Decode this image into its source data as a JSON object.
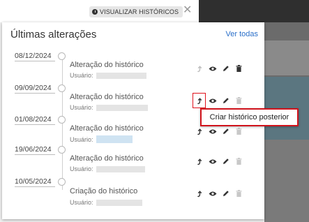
{
  "toolbar": {
    "visualizar_label": "VISUALIZAR HISTÓRICOS"
  },
  "panel": {
    "title": "Últimas alterações",
    "see_all": "Ver todas"
  },
  "entries": [
    {
      "date": "08/12/2024",
      "title": "Alteração do histórico",
      "user_label": "Usuário:",
      "restore_enabled": false,
      "delete_enabled": true
    },
    {
      "date": "09/09/2024",
      "title": "Alteração do histórico",
      "user_label": "Usuário:",
      "restore_enabled": true,
      "delete_enabled": false
    },
    {
      "date": "01/08/2024",
      "title": "Alteração do histórico",
      "user_label": "Usuário:",
      "restore_enabled": true,
      "delete_enabled": false
    },
    {
      "date": "19/06/2024",
      "title": "Alteração do histórico",
      "user_label": "Usuário:",
      "restore_enabled": true,
      "delete_enabled": false
    },
    {
      "date": "10/05/2024",
      "title": "Criação do histórico",
      "user_label": "Usuário:",
      "restore_enabled": true,
      "delete_enabled": false
    }
  ],
  "tooltip": {
    "text": "Criar histórico posterior"
  },
  "icons": {
    "restore": "arrow-up-icon",
    "view": "eye-icon",
    "edit": "pencil-icon",
    "delete": "trash-icon"
  },
  "colors": {
    "link": "#2a6fc9",
    "highlight": "#d0131c"
  }
}
